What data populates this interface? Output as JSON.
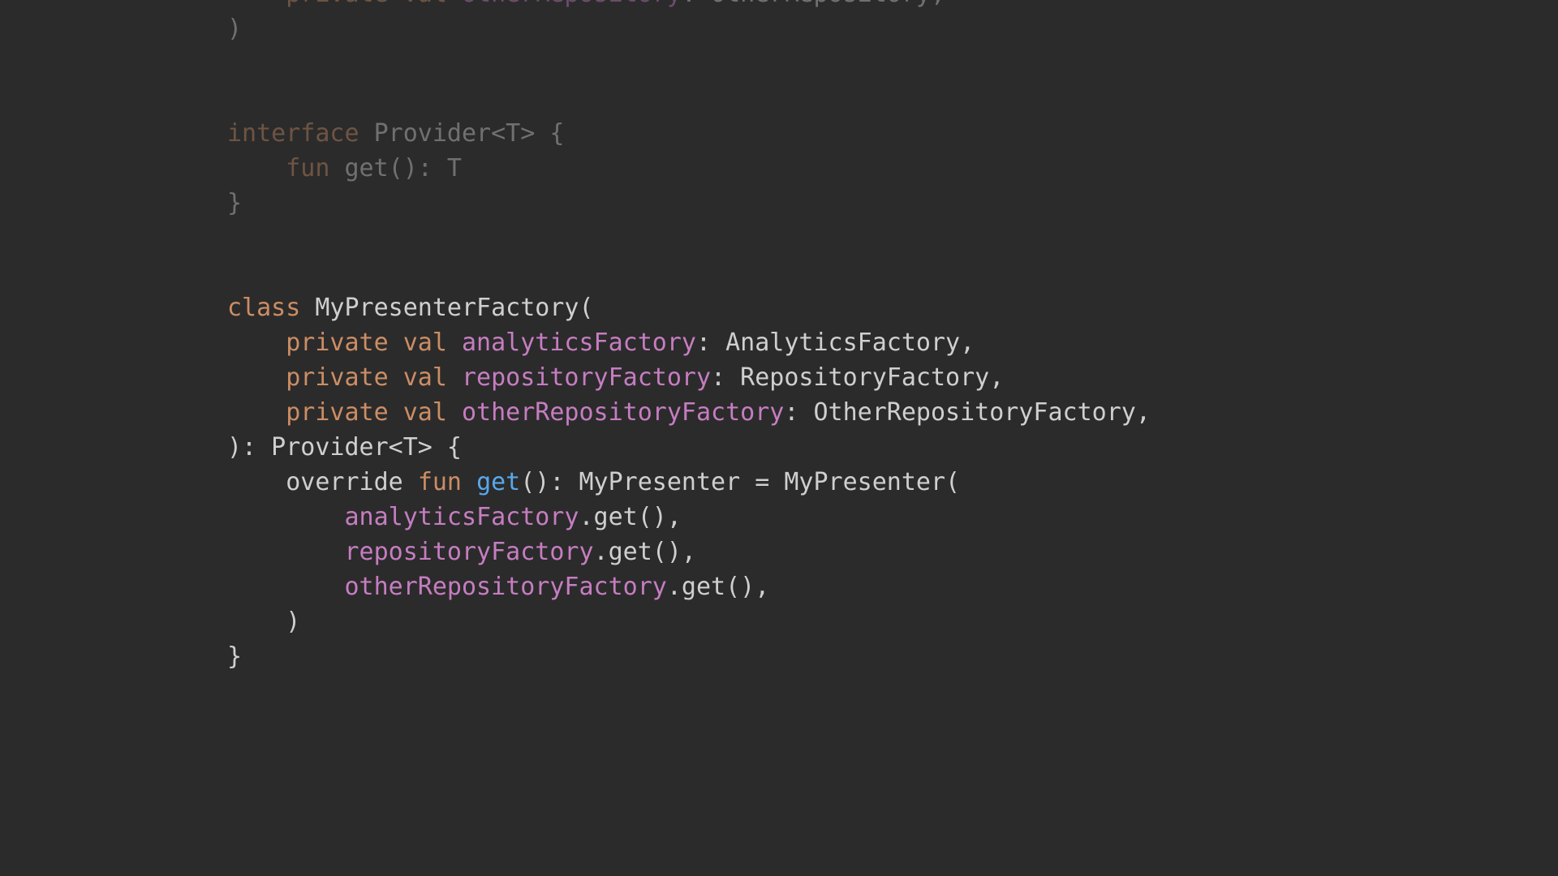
{
  "editor": {
    "background": "#2b2b2b",
    "colors": {
      "keyword": "#cc8d64",
      "plain": "#cfcfcf",
      "property": "#c67dc1",
      "function": "#58a8ea"
    },
    "lines": [
      {
        "dim": true,
        "tokens": [
          {
            "t": "    ",
            "c": "plain"
          },
          {
            "t": "private",
            "c": "keyword"
          },
          {
            "t": " ",
            "c": "plain"
          },
          {
            "t": "val",
            "c": "keyword"
          },
          {
            "t": " ",
            "c": "plain"
          },
          {
            "t": "otherRepository",
            "c": "prop"
          },
          {
            "t": ": OtherRepository,",
            "c": "plain"
          }
        ]
      },
      {
        "dim": true,
        "tokens": [
          {
            "t": ")",
            "c": "plain"
          }
        ]
      },
      {
        "dim": true,
        "tokens": []
      },
      {
        "dim": true,
        "tokens": []
      },
      {
        "dim": true,
        "tokens": [
          {
            "t": "interface",
            "c": "keyword"
          },
          {
            "t": " Provider<T> {",
            "c": "plain"
          }
        ]
      },
      {
        "dim": true,
        "tokens": [
          {
            "t": "    ",
            "c": "plain"
          },
          {
            "t": "fun",
            "c": "keyword"
          },
          {
            "t": " get(): T",
            "c": "plain"
          }
        ]
      },
      {
        "dim": true,
        "tokens": [
          {
            "t": "}",
            "c": "plain"
          }
        ]
      },
      {
        "dim": false,
        "tokens": []
      },
      {
        "dim": false,
        "tokens": []
      },
      {
        "dim": false,
        "tokens": [
          {
            "t": "class",
            "c": "keyword"
          },
          {
            "t": " MyPresenterFactory(",
            "c": "plain"
          }
        ]
      },
      {
        "dim": false,
        "tokens": [
          {
            "t": "    ",
            "c": "plain"
          },
          {
            "t": "private",
            "c": "keyword"
          },
          {
            "t": " ",
            "c": "plain"
          },
          {
            "t": "val",
            "c": "keyword"
          },
          {
            "t": " ",
            "c": "plain"
          },
          {
            "t": "analyticsFactory",
            "c": "prop"
          },
          {
            "t": ": AnalyticsFactory,",
            "c": "plain"
          }
        ]
      },
      {
        "dim": false,
        "tokens": [
          {
            "t": "    ",
            "c": "plain"
          },
          {
            "t": "private",
            "c": "keyword"
          },
          {
            "t": " ",
            "c": "plain"
          },
          {
            "t": "val",
            "c": "keyword"
          },
          {
            "t": " ",
            "c": "plain"
          },
          {
            "t": "repositoryFactory",
            "c": "prop"
          },
          {
            "t": ": RepositoryFactory,",
            "c": "plain"
          }
        ]
      },
      {
        "dim": false,
        "tokens": [
          {
            "t": "    ",
            "c": "plain"
          },
          {
            "t": "private",
            "c": "keyword"
          },
          {
            "t": " ",
            "c": "plain"
          },
          {
            "t": "val",
            "c": "keyword"
          },
          {
            "t": " ",
            "c": "plain"
          },
          {
            "t": "otherRepositoryFactory",
            "c": "prop"
          },
          {
            "t": ": OtherRepositoryFactory,",
            "c": "plain"
          }
        ]
      },
      {
        "dim": false,
        "tokens": [
          {
            "t": "): Provider<T> {",
            "c": "plain"
          }
        ]
      },
      {
        "dim": false,
        "tokens": [
          {
            "t": "    override ",
            "c": "plain"
          },
          {
            "t": "fun",
            "c": "keyword"
          },
          {
            "t": " ",
            "c": "plain"
          },
          {
            "t": "get",
            "c": "func"
          },
          {
            "t": "(): MyPresenter = MyPresenter(",
            "c": "plain"
          }
        ]
      },
      {
        "dim": false,
        "tokens": [
          {
            "t": "        ",
            "c": "plain"
          },
          {
            "t": "analyticsFactory",
            "c": "prop"
          },
          {
            "t": ".get(),",
            "c": "plain"
          }
        ]
      },
      {
        "dim": false,
        "tokens": [
          {
            "t": "        ",
            "c": "plain"
          },
          {
            "t": "repositoryFactory",
            "c": "prop"
          },
          {
            "t": ".get(),",
            "c": "plain"
          }
        ]
      },
      {
        "dim": false,
        "tokens": [
          {
            "t": "        ",
            "c": "plain"
          },
          {
            "t": "otherRepositoryFactory",
            "c": "prop"
          },
          {
            "t": ".get(),",
            "c": "plain"
          }
        ]
      },
      {
        "dim": false,
        "tokens": [
          {
            "t": "    )",
            "c": "plain"
          }
        ]
      },
      {
        "dim": false,
        "tokens": [
          {
            "t": "}",
            "c": "plain"
          }
        ]
      }
    ]
  }
}
